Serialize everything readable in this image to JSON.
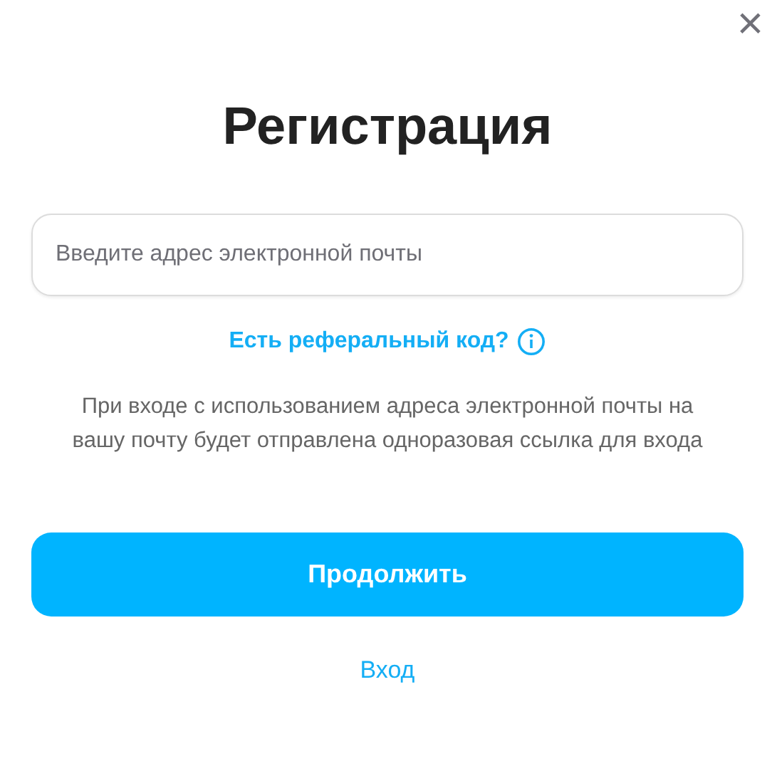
{
  "dialog": {
    "close_icon": "×",
    "title": "Регистрация",
    "email_field": {
      "placeholder": "Введите адрес электронной почты"
    },
    "referral_link": "Есть реферальный код?",
    "description": "При входе с использованием адреса электронной почты на вашу почту будет отправлена одноразовая ссылка для входа",
    "continue_button": "Продолжить",
    "login_link": "Вход"
  }
}
